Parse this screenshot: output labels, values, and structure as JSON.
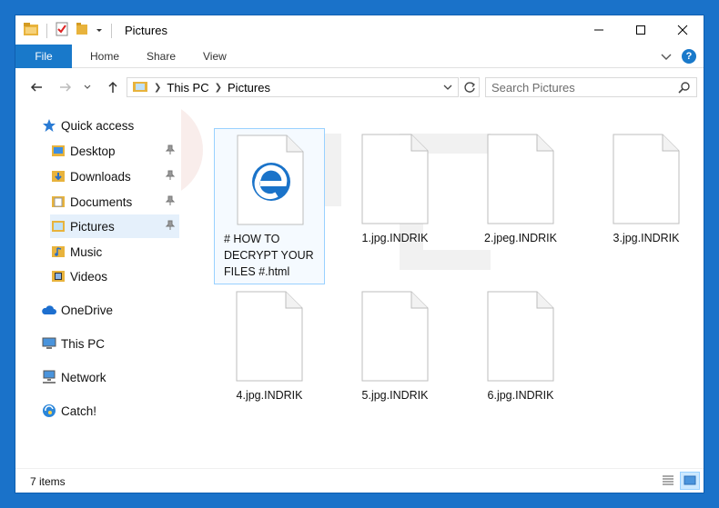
{
  "window": {
    "title": "Pictures"
  },
  "ribbon": {
    "tabs": [
      "File",
      "Home",
      "Share",
      "View"
    ]
  },
  "address": {
    "root": "This PC",
    "folder": "Pictures"
  },
  "search": {
    "placeholder": "Search Pictures"
  },
  "sidebar": {
    "quick_access": "Quick access",
    "items": [
      {
        "label": "Desktop",
        "pinned": true
      },
      {
        "label": "Downloads",
        "pinned": true
      },
      {
        "label": "Documents",
        "pinned": true
      },
      {
        "label": "Pictures",
        "pinned": true,
        "selected": true
      },
      {
        "label": "Music",
        "pinned": false
      },
      {
        "label": "Videos",
        "pinned": false
      }
    ],
    "onedrive": "OneDrive",
    "thispc": "This PC",
    "network": "Network",
    "catch": "Catch!"
  },
  "files": [
    {
      "name": "# HOW TO DECRYPT YOUR FILES #.html",
      "icon": "edge-html-icon",
      "selected": true
    },
    {
      "name": "1.jpg.INDRIK",
      "icon": "blank-file-icon"
    },
    {
      "name": "2.jpeg.INDRIK",
      "icon": "blank-file-icon"
    },
    {
      "name": "3.jpg.INDRIK",
      "icon": "blank-file-icon"
    },
    {
      "name": "4.jpg.INDRIK",
      "icon": "blank-file-icon"
    },
    {
      "name": "5.jpg.INDRIK",
      "icon": "blank-file-icon"
    },
    {
      "name": "6.jpg.INDRIK",
      "icon": "blank-file-icon"
    }
  ],
  "status": {
    "count": "7 items"
  },
  "colors": {
    "accent": "#1979ca",
    "selection": "#cce8ff",
    "folder": "#e8b33c"
  }
}
